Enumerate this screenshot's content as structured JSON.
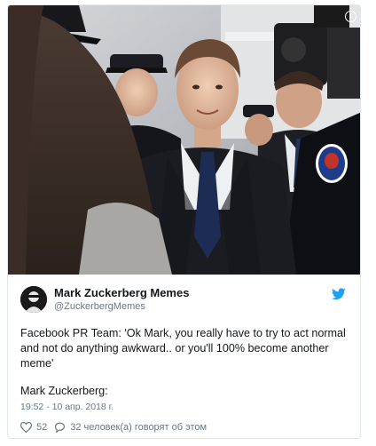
{
  "tweet": {
    "display_name": "Mark Zuckerberg Memes",
    "handle": "@ZuckerbergMemes",
    "text": "Facebook PR Team: 'Ok Mark, you really have to try to act normal and not do anything awkward.. or you'll 100% become another meme'",
    "footer_line": "Mark Zuckerberg:",
    "timestamp": "19:52 - 10 апр. 2018 г.",
    "likes": "52",
    "replies_text": "32 человек(а) говорят об этом"
  },
  "icons": {
    "info": "info-icon",
    "bird": "twitter-bird-icon",
    "heart": "heart-icon",
    "reply": "reply-bubble-icon"
  },
  "colors": {
    "twitter_blue": "#1da1f2",
    "muted": "#657786",
    "text": "#14171a",
    "border": "#e1e8ed"
  }
}
